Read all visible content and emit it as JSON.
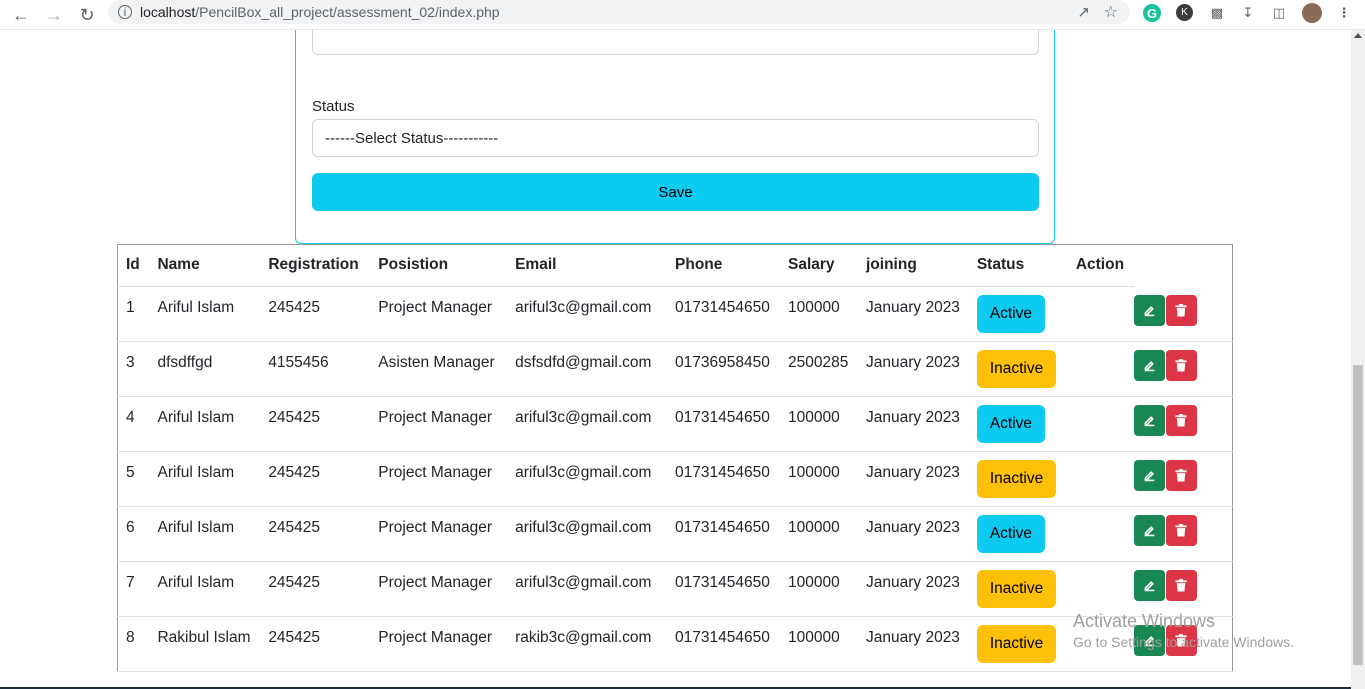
{
  "browser": {
    "url_host": "localhost",
    "url_path": "/PencilBox_all_project/assessment_02/index.php"
  },
  "form": {
    "status_label": "Status",
    "status_selected": "------Select Status-----------",
    "save_label": "Save"
  },
  "table": {
    "headers": [
      "Id",
      "Name",
      "Registration",
      "Posistion",
      "Email",
      "Phone",
      "Salary",
      "joining",
      "Status",
      "Action"
    ],
    "rows": [
      {
        "id": "1",
        "name": "Ariful Islam",
        "reg": "245425",
        "position": "Project Manager",
        "email": "ariful3c@gmail.com",
        "phone": "01731454650",
        "salary": "100000",
        "joining": "January 2023",
        "status": "Active"
      },
      {
        "id": "3",
        "name": "dfsdffgd",
        "reg": "4155456",
        "position": "Asisten Manager",
        "email": "dsfsdfd@gmail.com",
        "phone": "01736958450",
        "salary": "2500285",
        "joining": "January 2023",
        "status": "Inactive"
      },
      {
        "id": "4",
        "name": "Ariful Islam",
        "reg": "245425",
        "position": "Project Manager",
        "email": "ariful3c@gmail.com",
        "phone": "01731454650",
        "salary": "100000",
        "joining": "January 2023",
        "status": "Active"
      },
      {
        "id": "5",
        "name": "Ariful Islam",
        "reg": "245425",
        "position": "Project Manager",
        "email": "ariful3c@gmail.com",
        "phone": "01731454650",
        "salary": "100000",
        "joining": "January 2023",
        "status": "Inactive"
      },
      {
        "id": "6",
        "name": "Ariful Islam",
        "reg": "245425",
        "position": "Project Manager",
        "email": "ariful3c@gmail.com",
        "phone": "01731454650",
        "salary": "100000",
        "joining": "January 2023",
        "status": "Active"
      },
      {
        "id": "7",
        "name": "Ariful Islam",
        "reg": "245425",
        "position": "Project Manager",
        "email": "ariful3c@gmail.com",
        "phone": "01731454650",
        "salary": "100000",
        "joining": "January 2023",
        "status": "Inactive"
      },
      {
        "id": "8",
        "name": "Rakibul Islam",
        "reg": "245425",
        "position": "Project Manager",
        "email": "rakib3c@gmail.com",
        "phone": "01731454650",
        "salary": "100000",
        "joining": "January 2023",
        "status": "Inactive"
      }
    ]
  },
  "watermark": {
    "line1": "Activate Windows",
    "line2": "Go to Settings to activate Windows."
  },
  "colors": {
    "info": "#0dcaf0",
    "warning": "#ffc107",
    "success": "#198754",
    "danger": "#dc3545"
  }
}
